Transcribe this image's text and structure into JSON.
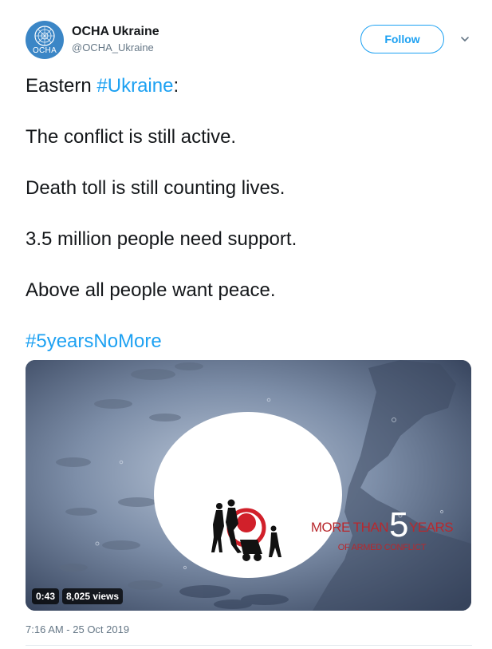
{
  "account": {
    "display_name": "OCHA Ukraine",
    "handle": "@OCHA_Ukraine",
    "avatar_label": "OCHA"
  },
  "actions": {
    "follow_label": "Follow",
    "more_icon": "chevron-down-icon"
  },
  "tweet": {
    "line1_prefix": "Eastern ",
    "line1_hashtag": "#Ukraine",
    "line1_suffix": ":",
    "line2": "The conflict is still active.",
    "line3": "Death toll is still counting lives.",
    "line4": "3.5 million people need support.",
    "line5": "Above all people want peace.",
    "hashtag": "#5yearsNoMore"
  },
  "media": {
    "overlay_prefix": "MORE THAN",
    "overlay_number": "5",
    "overlay_suffix": "YEARS",
    "overlay_sub": "OF ARMED CONFLICT",
    "duration": "0:43",
    "views": "8,025 views"
  },
  "timestamp": "7:16 AM - 25 Oct 2019",
  "colors": {
    "accent": "#1da1f2",
    "text": "#14171a",
    "secondary": "#657786",
    "overlay_red": "#b8282d",
    "avatar_blue": "#3b86c6"
  }
}
